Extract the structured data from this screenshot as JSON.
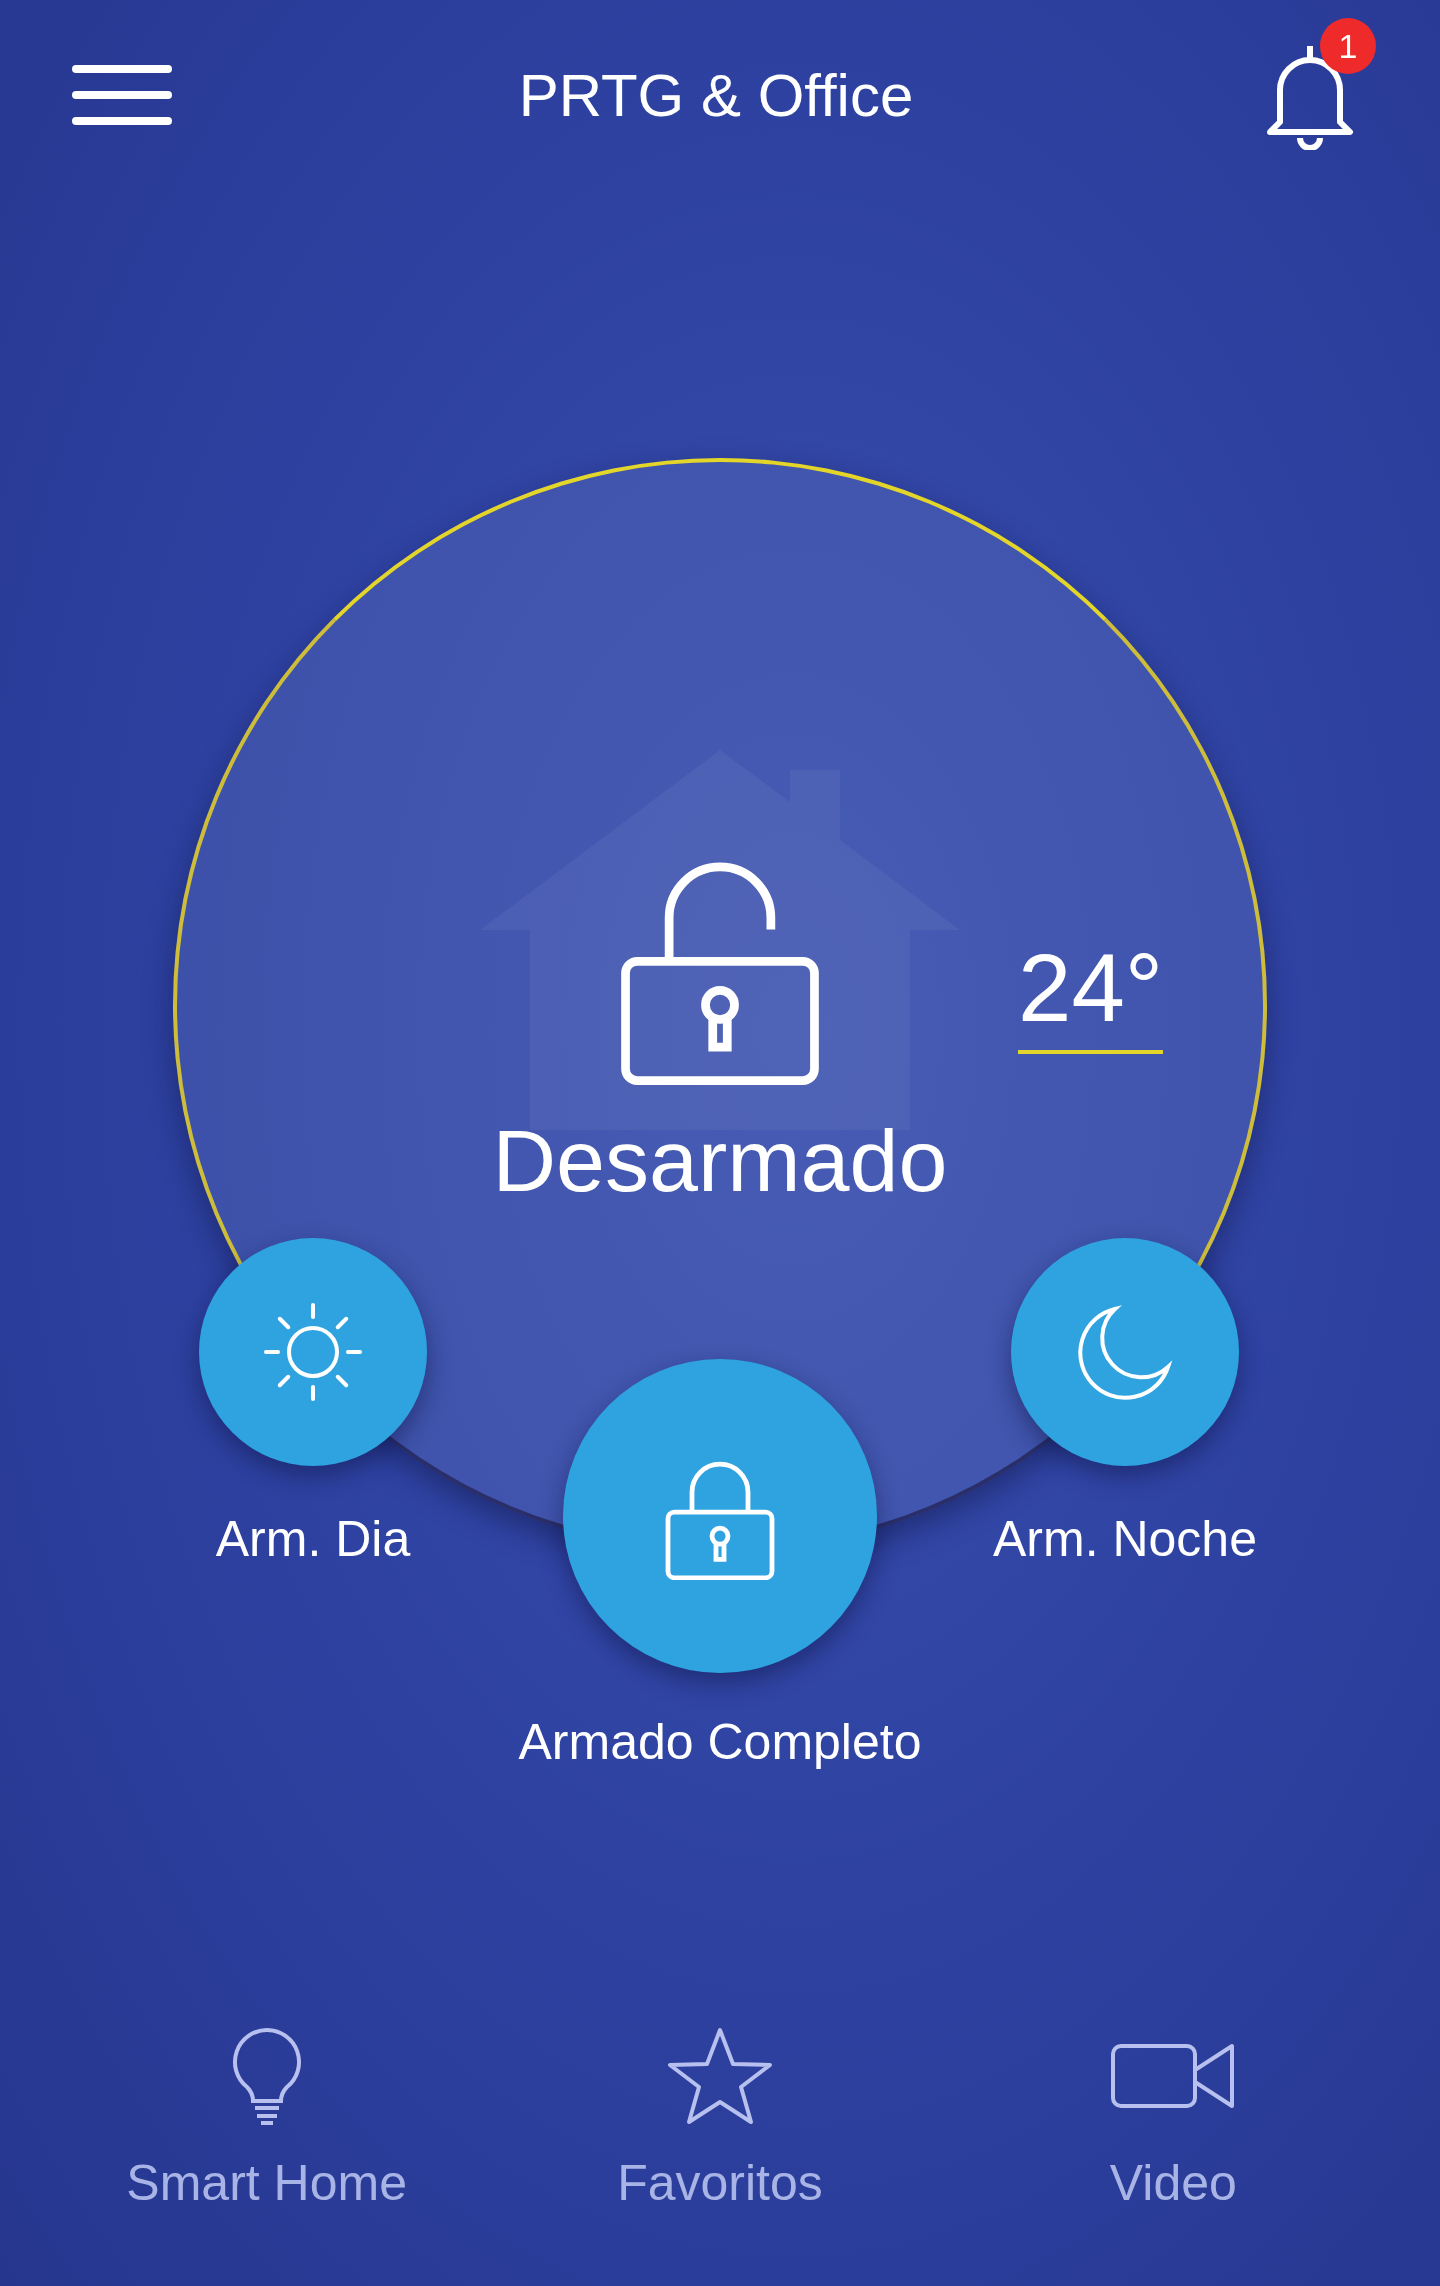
{
  "header": {
    "title": "PRTG & Office",
    "notification_count": "1"
  },
  "status": {
    "label": "Desarmado",
    "temperature": "24°"
  },
  "modes": [
    {
      "kind": "day",
      "label": "Arm. Dia"
    },
    {
      "kind": "full",
      "label": "Armado Completo"
    },
    {
      "kind": "night",
      "label": "Arm. Noche"
    }
  ],
  "nav": [
    {
      "kind": "bulb",
      "label": "Smart Home"
    },
    {
      "kind": "star",
      "label": "Favoritos"
    },
    {
      "kind": "video",
      "label": "Video"
    }
  ]
}
